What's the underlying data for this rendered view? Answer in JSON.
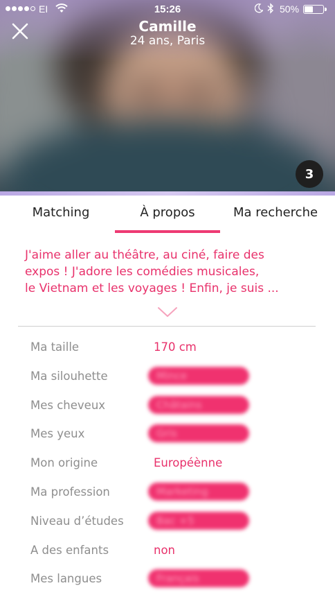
{
  "status_bar": {
    "carrier": "EI",
    "time": "15:26",
    "battery_percent": "50%",
    "battery_level": 0.5,
    "signal_bars_filled": 4,
    "signal_bars_total": 5
  },
  "header": {
    "name": "Camille",
    "subtitle": "24 ans, Paris",
    "photo_count": "3",
    "close_icon": "close-icon"
  },
  "tabs": [
    {
      "label": "Matching",
      "active": false
    },
    {
      "label": "À propos",
      "active": true
    },
    {
      "label": "Ma recherche",
      "active": false
    }
  ],
  "bio": {
    "lines": [
      "J'aime aller au théâtre, au ciné, faire des",
      "expos ! J'adore les comédies musicales,",
      "le Vietnam et les voyages ! Enfin, je suis ..."
    ],
    "expand_icon": "chevron-down-icon"
  },
  "attributes": [
    {
      "label": "Ma taille",
      "value": "170 cm",
      "blurred": false
    },
    {
      "label": "Ma silouhette",
      "value": "Mince",
      "blurred": true
    },
    {
      "label": "Mes cheveux",
      "value": "Châtains",
      "blurred": true
    },
    {
      "label": "Mes yeux",
      "value": "Gris",
      "blurred": true
    },
    {
      "label": "Mon origine",
      "value": "Européènne",
      "blurred": false
    },
    {
      "label": "Ma profession",
      "value": "Marketing",
      "blurred": true
    },
    {
      "label": "Niveau d’études",
      "value": "Bac +5",
      "blurred": true
    },
    {
      "label": "A des enfants",
      "value": "non",
      "blurred": false
    },
    {
      "label": "Mes langues",
      "value": "Français",
      "blurred": true
    }
  ],
  "colors": {
    "accent": "#e8316b",
    "label_gray": "#8e8e8e",
    "badge_bg": "#1f1f1f"
  }
}
